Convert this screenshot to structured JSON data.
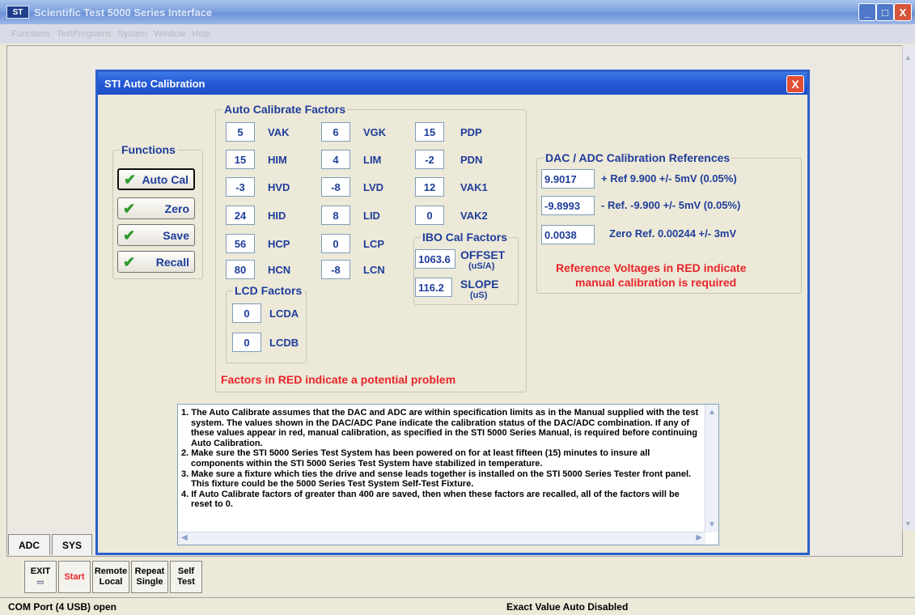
{
  "main_window": {
    "logo": "ST",
    "title": "Scientific Test 5000 Series Interface",
    "controls": {
      "min": "_",
      "max": "□",
      "close": "X"
    }
  },
  "menu": {
    "items": [
      "Functions",
      "TestPrograms",
      "System",
      "Window",
      "Help"
    ]
  },
  "tabs": [
    "ADC",
    "SYS"
  ],
  "toolbar": {
    "exit_label": "EXIT",
    "start_label": "Start",
    "remote_line1": "Remote",
    "remote_line2": "Local",
    "repeat_line1": "Repeat",
    "repeat_line2": "Single",
    "self_line1": "Self",
    "self_line2": "Test"
  },
  "status": {
    "com_port": "COM Port (4 USB) open",
    "exact_value": "Exact Value Auto Disabled"
  },
  "dialog": {
    "title": "STI Auto Calibration",
    "close": "X",
    "functions": {
      "legend": "Functions",
      "buttons": [
        "Auto Cal",
        "Zero",
        "Save",
        "Recall"
      ]
    },
    "factors": {
      "legend": "Auto Calibrate Factors",
      "rows": [
        [
          {
            "value": "5",
            "label": "VAK"
          },
          {
            "value": "6",
            "label": "VGK"
          },
          {
            "value": "15",
            "label": "PDP"
          }
        ],
        [
          {
            "value": "15",
            "label": "HIM"
          },
          {
            "value": "4",
            "label": "LIM"
          },
          {
            "value": "-2",
            "label": "PDN"
          }
        ],
        [
          {
            "value": "-3",
            "label": "HVD"
          },
          {
            "value": "-8",
            "label": "LVD"
          },
          {
            "value": "12",
            "label": "VAK1"
          }
        ],
        [
          {
            "value": "24",
            "label": "HID"
          },
          {
            "value": "8",
            "label": "LID"
          },
          {
            "value": "0",
            "label": "VAK2"
          }
        ],
        [
          {
            "value": "56",
            "label": "HCP"
          },
          {
            "value": "0",
            "label": "LCP"
          }
        ],
        [
          {
            "value": "80",
            "label": "HCN"
          },
          {
            "value": "-8",
            "label": "LCN"
          }
        ]
      ],
      "warning": "Factors in RED indicate a potential problem"
    },
    "ibo": {
      "legend": "IBO Cal Factors",
      "offset_value": "1063.6",
      "offset_label": "OFFSET",
      "offset_unit": "(uS/A)",
      "slope_value": "116.2",
      "slope_label": "SLOPE",
      "slope_unit": "(uS)"
    },
    "lcd": {
      "legend": "LCD Factors",
      "items": [
        {
          "value": "0",
          "label": "LCDA"
        },
        {
          "value": "0",
          "label": "LCDB"
        }
      ]
    },
    "refs": {
      "legend": "DAC / ADC Calibration References",
      "items": [
        {
          "value": "9.9017",
          "label": "+ Ref 9.900 +/- 5mV (0.05%)"
        },
        {
          "value": "-9.8993",
          "label": "- Ref. -9.900 +/- 5mV (0.05%)"
        },
        {
          "value": "0.0038",
          "label": "Zero Ref. 0.00244 +/- 3mV"
        }
      ],
      "note_line1": "Reference Voltages in RED indicate",
      "note_line2": "manual calibration is required"
    },
    "notes": [
      "1. The Auto Calibrate assumes that the DAC and ADC are within specification limits as in the Manual supplied with the test system.  The values shown in the DAC/ADC Pane indicate the calibration status of the DAC/ADC combination.  If any of these values appear in red, manual calibration, as specified in the STI 5000 Series Manual, is required before continuing Auto Calibration.",
      "2. Make sure the STI 5000 Series Test System has been powered on for at least fifteen (15) minutes to insure all components within the STI 5000 Series Test System have stabilized in temperature.",
      "3. Make sure a fixture which ties the drive and sense leads together is installed on the STI 5000 Series Tester front panel.  This fixture could be the 5000 Series Test System Self-Test Fixture.",
      "4. If Auto Calibrate factors of greater than 400 are saved, then when these factors are recalled, all of the factors will be reset to 0."
    ]
  }
}
